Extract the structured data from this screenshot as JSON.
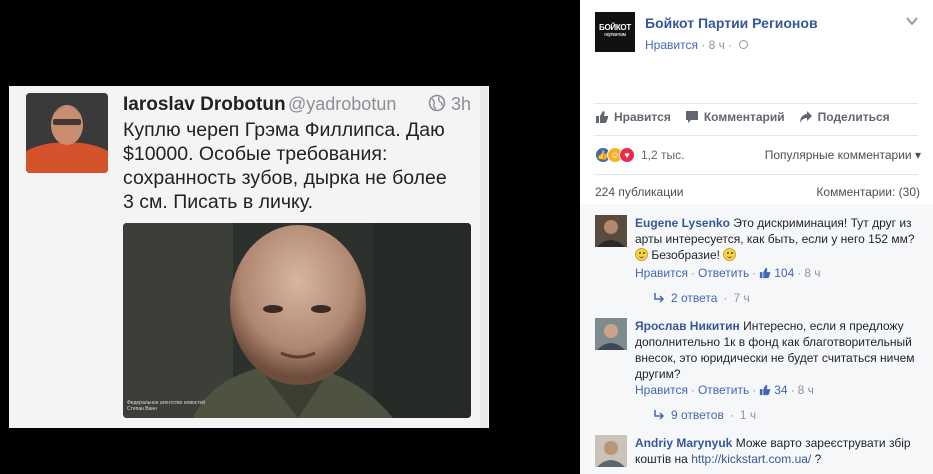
{
  "tweet": {
    "name": "Iaroslav Drobotun",
    "handle": "@yadrobotun",
    "time": "3h",
    "text": "Куплю череп Грэма Филлипса. Даю\n$10000. Особые требования:\nсохранность зубов, дырка не более\n3 см. Писать в личку.",
    "photo_caption": "Федеральное агентство новостей\nСтепан Ванн"
  },
  "page": {
    "logo_text": "БОЙКОТ",
    "logo_sub": "окупантам",
    "name": "Бойкот Партии Регионов",
    "meta_like": "Нравится",
    "meta_dot": "·",
    "meta_time": "8 ч",
    "meta_dot2": "·"
  },
  "actions": {
    "like": "Нравится",
    "comment": "Комментарий",
    "share": "Поделиться"
  },
  "reactions": {
    "count": "1,2 тыс.",
    "popular": "Популярные комментарии ▾"
  },
  "stats": {
    "shares": "224 публикации",
    "comments": "Комментарии: (30)"
  },
  "comments": [
    {
      "author": "Eugene Lysenko",
      "text": "Это дискриминация! Тут друг из арты интересуется, как быть, если у него 152 мм?",
      "text_tail": "Безобразие!",
      "like": "Нравится",
      "dot1": "·",
      "reply": "Ответить",
      "dot2": "·",
      "likes": "104",
      "dot3": "·",
      "time": "8 ч",
      "replies": "2 ответа",
      "replies_dot": "·",
      "replies_time": "7 ч"
    },
    {
      "author": "Ярослав Никитин",
      "text": "Интересно, если я предложу дополнительно 1к в фонд как благотворительный внесок, это юридически не будет считаться ничем другим?",
      "like": "Нравится",
      "dot1": "·",
      "reply": "Ответить",
      "dot2": "·",
      "likes": "34",
      "dot3": "·",
      "time": "8 ч",
      "replies": "9 ответов",
      "replies_dot": "·",
      "replies_time": "1 ч"
    },
    {
      "author": "Andriy Marynyuk",
      "text": "Може варто зареєструвати збір коштів на",
      "link": "http://kickstart.com.ua/",
      "text_tail": "?"
    }
  ],
  "colors": {
    "accent": "#365899",
    "like_blue": "#4267b2",
    "muted": "#90949c"
  }
}
